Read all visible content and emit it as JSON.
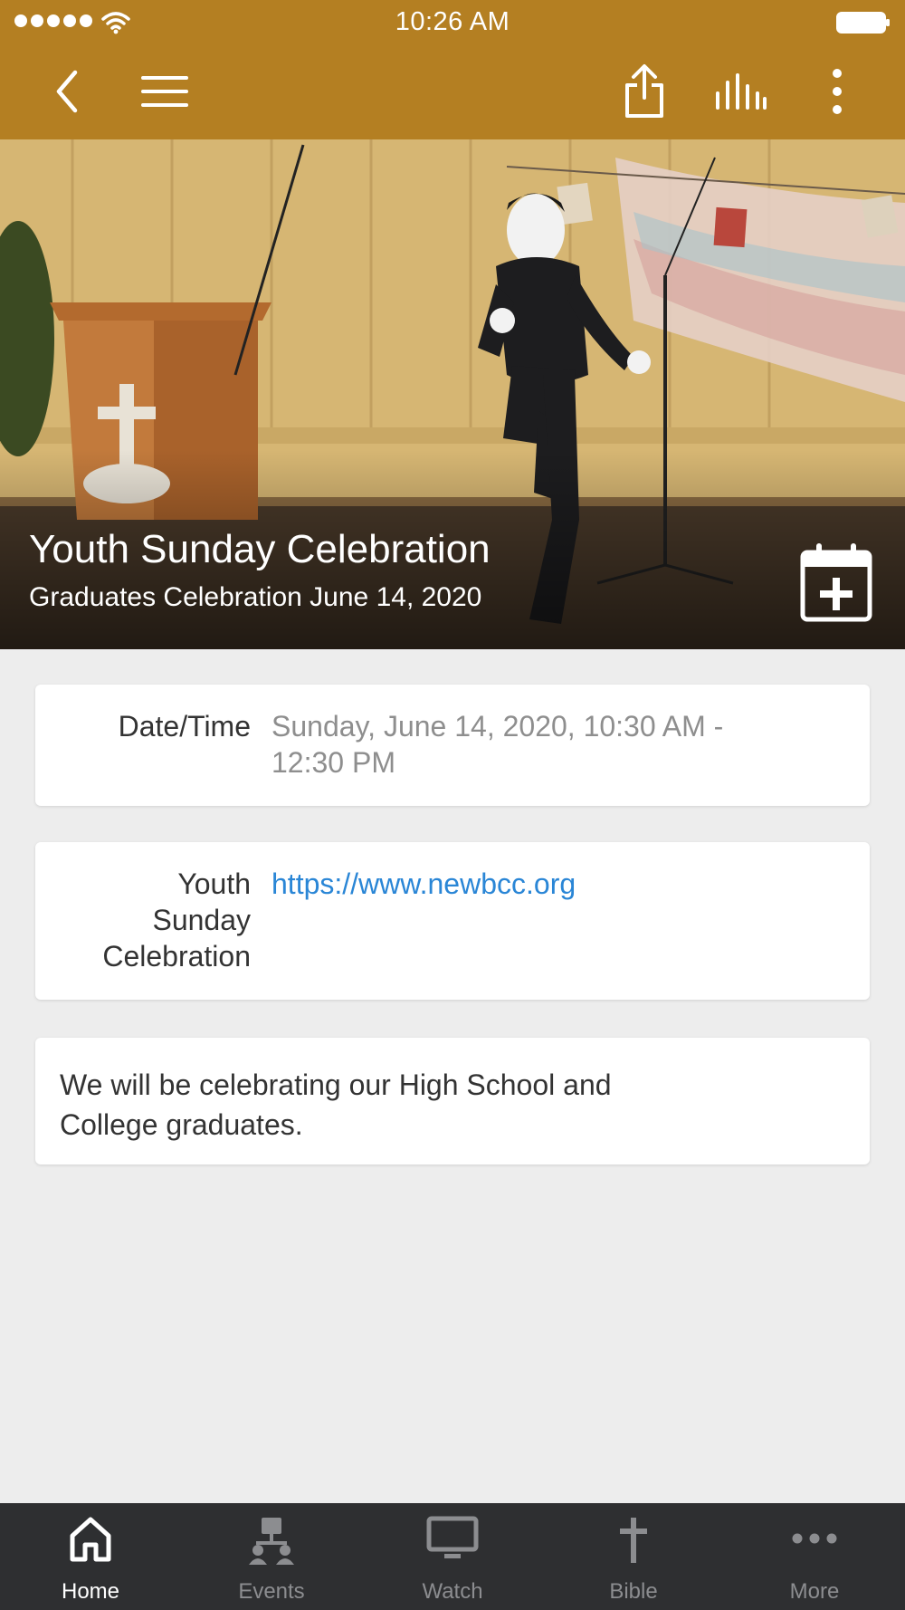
{
  "status_bar": {
    "time": "10:26 AM"
  },
  "header": {
    "icons": [
      "back-icon",
      "menu-icon",
      "share-icon",
      "audio-bars-icon",
      "more-vertical-icon"
    ]
  },
  "event": {
    "title": "Youth Sunday Celebration",
    "subtitle": "Graduates Celebration June 14, 2020",
    "add_to_calendar_icon": "calendar-plus-icon"
  },
  "details": {
    "datetime_label": "Date/Time",
    "datetime_value_line1": "Sunday, June 14, 2020, 10:30 AM -",
    "datetime_value_line2": "12:30 PM",
    "link_label_line1": "Youth",
    "link_label_line2": "Sunday",
    "link_label_line3": "Celebration",
    "link_url": "https://www.newbcc.org",
    "description_line1": "We will be celebrating our High School and",
    "description_line2": "College graduates."
  },
  "tabs": [
    {
      "label": "Home",
      "icon": "home-icon",
      "active": true
    },
    {
      "label": "Events",
      "icon": "events-icon",
      "active": false
    },
    {
      "label": "Watch",
      "icon": "monitor-icon",
      "active": false
    },
    {
      "label": "Bible",
      "icon": "cross-icon",
      "active": false
    },
    {
      "label": "More",
      "icon": "more-horizontal-icon",
      "active": false
    }
  ],
  "colors": {
    "header_bg": "#b47f22",
    "link": "#2a86d6",
    "tabbar_bg": "#2e2f31",
    "page_bg": "#ededed"
  }
}
